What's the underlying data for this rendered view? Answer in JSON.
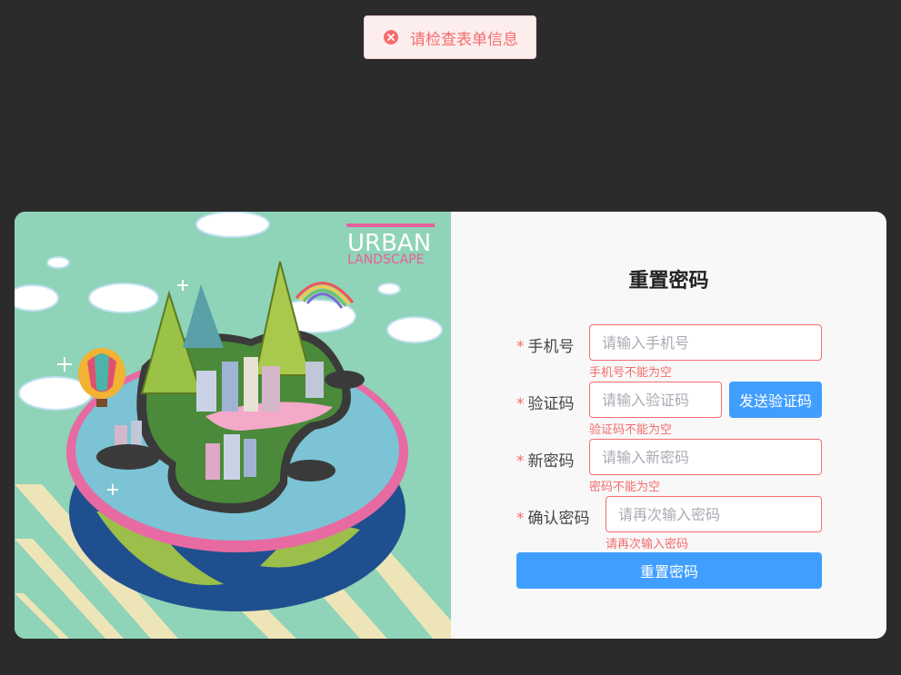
{
  "toast": {
    "message": "请检查表单信息",
    "icon": "error-circle-icon"
  },
  "illustration": {
    "title": "URBAN",
    "subtitle": "LANDSCAPE"
  },
  "form": {
    "title": "重置密码",
    "required_mark": "*",
    "phone": {
      "label": "手机号",
      "placeholder": "请输入手机号",
      "value": "",
      "error": "手机号不能为空"
    },
    "code": {
      "label": "验证码",
      "placeholder": "请输入验证码",
      "value": "",
      "error": "验证码不能为空",
      "send_label": "发送验证码"
    },
    "new_password": {
      "label": "新密码",
      "placeholder": "请输入新密码",
      "value": "",
      "error": "密码不能为空"
    },
    "confirm_password": {
      "label": "确认密码",
      "placeholder": "请再次输入密码",
      "value": "",
      "error": "请再次输入密码"
    },
    "submit_label": "重置密码"
  },
  "colors": {
    "page_bg": "#2b2b2b",
    "card_bg": "#f8f8f8",
    "primary": "#409eff",
    "error": "#f56c6c",
    "illustration_bg": "#8fd3b8"
  }
}
